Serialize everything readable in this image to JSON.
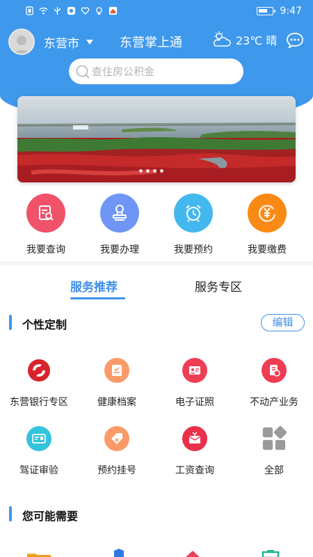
{
  "status_bar": {
    "time": "9:47"
  },
  "header": {
    "city": "东营市",
    "app_title": "东营掌上通",
    "weather": "23℃ 晴"
  },
  "search": {
    "placeholder": "查住房公积金"
  },
  "quick_actions": [
    {
      "label": "我要查询",
      "icon": "search-document-icon",
      "color": "#f0526a"
    },
    {
      "label": "我要办理",
      "icon": "stamp-icon",
      "color": "#6f96f5"
    },
    {
      "label": "我要预约",
      "icon": "alarm-clock-icon",
      "color": "#43b8ee"
    },
    {
      "label": "我要缴费",
      "icon": "yen-coin-icon",
      "color": "#fb8a15"
    }
  ],
  "tabs": [
    {
      "label": "服务推荐",
      "active": true
    },
    {
      "label": "服务专区",
      "active": false
    }
  ],
  "custom_section": {
    "title": "个性定制",
    "edit_label": "编辑",
    "services": [
      {
        "label": "东营银行专区",
        "icon": "bank-logo-icon"
      },
      {
        "label": "健康档案",
        "icon": "health-record-icon"
      },
      {
        "label": "电子证照",
        "icon": "id-card-icon"
      },
      {
        "label": "不动产业务",
        "icon": "property-document-icon"
      },
      {
        "label": "驾证审验",
        "icon": "driver-license-icon"
      },
      {
        "label": "预约挂号",
        "icon": "registration-tag-icon"
      },
      {
        "label": "工资查询",
        "icon": "salary-envelope-icon"
      },
      {
        "label": "全部",
        "icon": "all-apps-icon"
      }
    ]
  },
  "maybe_section": {
    "title": "您可能需要"
  },
  "colors": {
    "brand": "#3e98ec",
    "accent": "#3e8fe8"
  }
}
